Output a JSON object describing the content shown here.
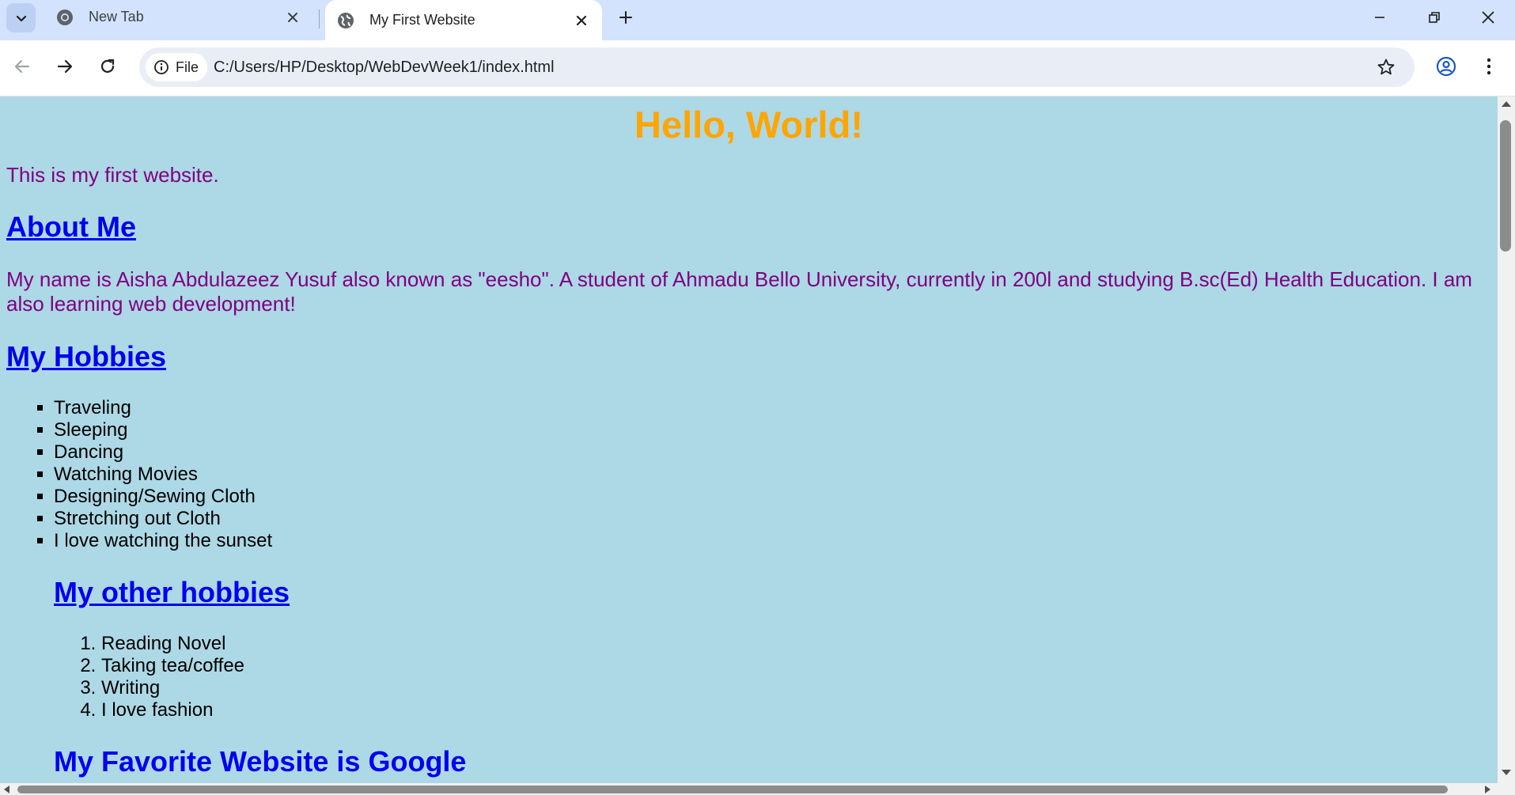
{
  "browser": {
    "tabs": [
      {
        "title": "New Tab",
        "favicon": "chrome-icon",
        "active": false
      },
      {
        "title": "My First Website",
        "favicon": "globe-icon",
        "active": true
      }
    ],
    "address": {
      "chip_label": "File",
      "url": "C:/Users/HP/Desktop/WebDevWeek1/index.html"
    }
  },
  "page": {
    "heading": "Hello, World!",
    "intro": "This is my first website.",
    "about_heading": "About Me",
    "bio": "My name is Aisha Abdulazeez Yusuf also known as \"eesho\". A student of Ahmadu Bello University, currently in 200l and studying B.sc(Ed) Health Education. I am also learning web development!",
    "hobbies_heading": "My Hobbies",
    "hobbies": [
      "Traveling",
      "Sleeping",
      "Dancing",
      "Watching Movies",
      "Designing/Sewing Cloth",
      "Stretching out Cloth",
      "I love watching the sunset"
    ],
    "other_hobbies_heading": "My other hobbies",
    "other_hobbies": [
      "Reading Novel",
      "Taking tea/coffee",
      "Writing",
      "I love fashion"
    ],
    "favorite_heading": "My Favorite Website is Google"
  },
  "colors": {
    "background": "#add8e6",
    "heading": "orange",
    "text": "purple",
    "link": "#0000ee"
  }
}
